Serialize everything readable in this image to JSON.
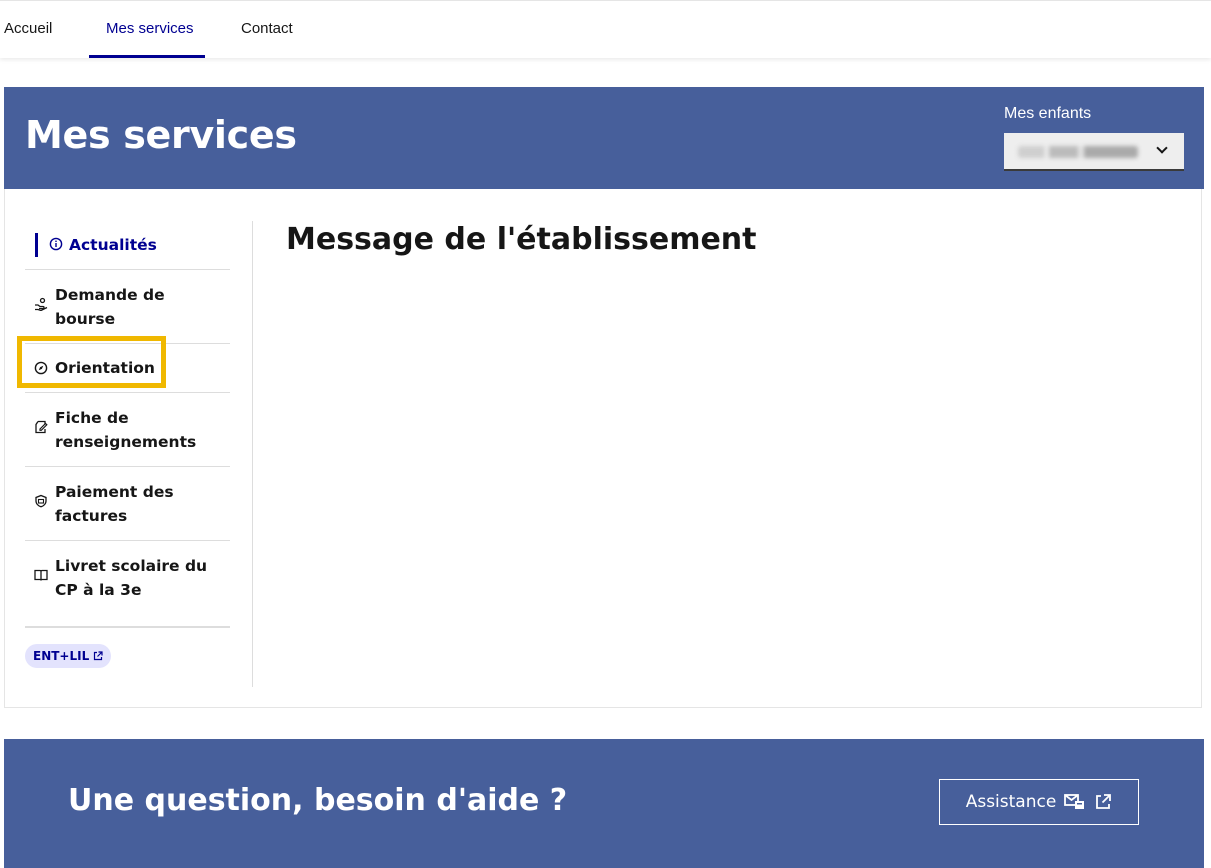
{
  "nav": {
    "items": [
      {
        "label": "Accueil"
      },
      {
        "label": "Mes services",
        "active": true
      },
      {
        "label": "Contact"
      }
    ]
  },
  "banner": {
    "title": "Mes services",
    "children_label": "Mes enfants",
    "children_selected": ""
  },
  "sidebar": {
    "items": [
      {
        "label": "Actualités",
        "icon": "info-icon",
        "current": true
      },
      {
        "label": "Demande de bourse",
        "icon": "hand-coins-icon"
      },
      {
        "label": "Orientation",
        "icon": "compass-icon",
        "highlighted": true
      },
      {
        "label": "Fiche de renseignements",
        "icon": "edit-document-icon"
      },
      {
        "label": "Paiement des factures",
        "icon": "payment-card-icon"
      },
      {
        "label": "Livret scolaire du CP à la 3e",
        "icon": "book-open-icon"
      }
    ],
    "external_badge": "ENT+LIL"
  },
  "main": {
    "title": "Message de l'établissement"
  },
  "help": {
    "title": "Une question, besoin d'aide ?",
    "assistance_label": "Assistance"
  },
  "colors": {
    "primary": "#000091",
    "banner": "#475f9b",
    "highlight": "#f0b800",
    "badge_bg": "#e3e3fd"
  }
}
